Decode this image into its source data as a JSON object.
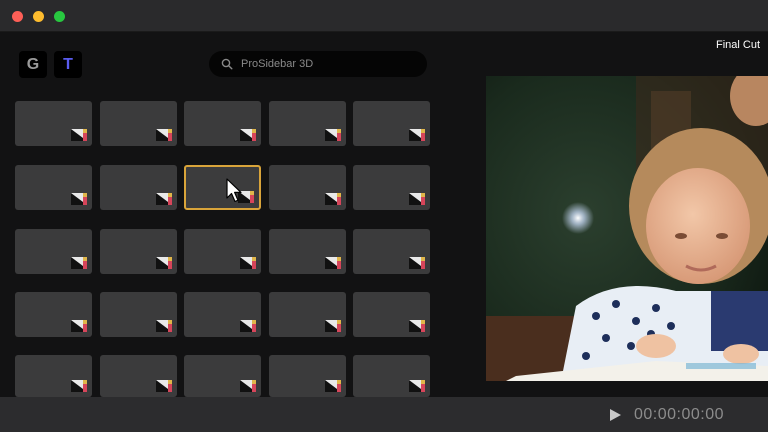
{
  "window": {
    "app_label": "Final Cut"
  },
  "toolbar": {
    "g_button": "G",
    "t_button": "T",
    "search_placeholder": "ProSidebar 3D"
  },
  "grid": {
    "rows": 5,
    "columns": 5,
    "selected_row": 2,
    "selected_column": 3,
    "tile_icon": "transition-thumbnail-icon"
  },
  "preview": {
    "content": "child reading a book"
  },
  "transport": {
    "play_icon": "play-icon",
    "timecode": "00:00:00:00"
  },
  "colors": {
    "selection": "#d9a43a",
    "close": "#fe5f57",
    "minimize": "#febc2e",
    "maximize": "#28c840",
    "t_accent": "#5a5cf0"
  }
}
